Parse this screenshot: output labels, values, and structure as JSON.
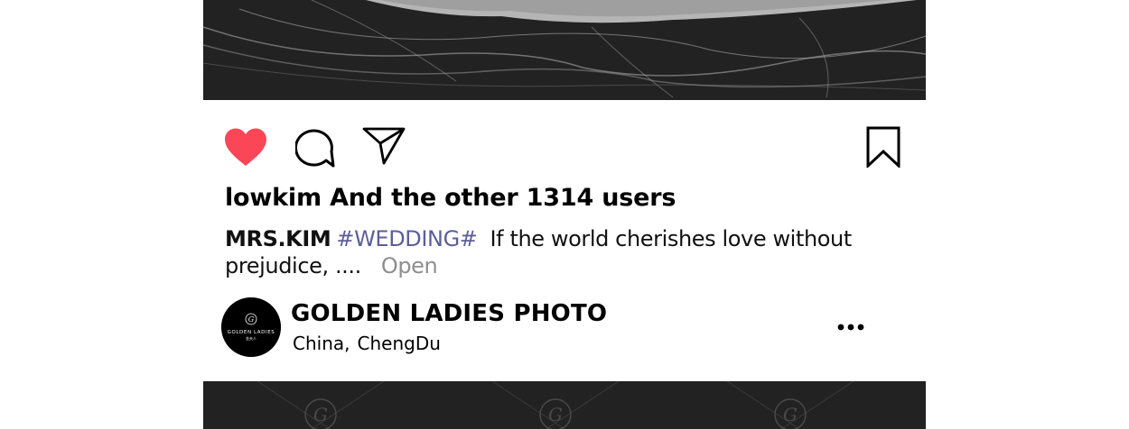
{
  "post": {
    "likes_text": "lowkim And the other 1314 users",
    "caption": {
      "username": "MRS.KIM",
      "hashtag": "#WEDDING#",
      "text_line1": "If the world cherishes love without",
      "text_line2": "prejudice, ....",
      "open_label": "Open"
    },
    "account": {
      "name": "GOLDEN LADIES PHOTO",
      "location_country": "China,",
      "location_city": "ChengDu",
      "avatar_text": "GOLDEN LADIES",
      "avatar_subtext": "金夫人",
      "avatar_monogram": "G"
    },
    "icons": {
      "like": "heart-icon",
      "comment": "comment-bubble-icon",
      "share": "paper-plane-icon",
      "save": "bookmark-icon",
      "more": "more-horizontal-icon",
      "watermark": "golden-ladies-watermark"
    }
  },
  "colors": {
    "like_red": "#fb4657",
    "hashtag": "#5c5f99",
    "muted": "#8e8e8e",
    "photo_bg": "#222222"
  }
}
